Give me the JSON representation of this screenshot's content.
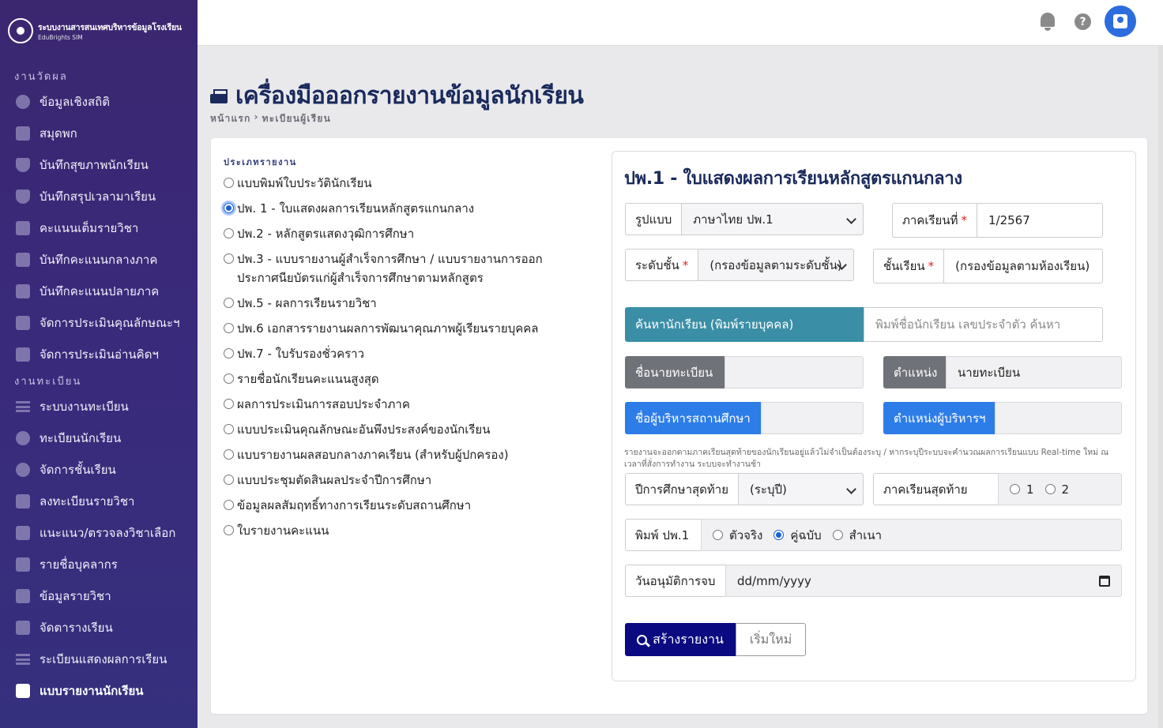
{
  "brand": {
    "title": "ระบบงานสารสนเทศบริหารข้อมูลโรงเรียน",
    "subtitle": "EduBrights SIM"
  },
  "sidebar": {
    "section1": "งานวัดผล",
    "items1": [
      {
        "label": "ข้อมูลเชิงสถิติ",
        "icon": "pie-chart-icon"
      },
      {
        "label": "สมุดพก",
        "icon": "book-icon"
      },
      {
        "label": "บันทึกสุขภาพนักเรียน",
        "icon": "shield-icon"
      },
      {
        "label": "บันทึกสรุปเวลามาเรียน",
        "icon": "shield-icon"
      },
      {
        "label": "คะแนนเต็มรายวิชา",
        "icon": "book-icon"
      },
      {
        "label": "บันทึกคะแนนกลางภาค",
        "icon": "book-icon"
      },
      {
        "label": "บันทึกคะแนนปลายภาค",
        "icon": "book-icon"
      },
      {
        "label": "จัดการประเมินคุณลักษณะฯ",
        "icon": "book-icon"
      },
      {
        "label": "จัดการประเมินอ่านคิดฯ",
        "icon": "book-icon"
      }
    ],
    "section2": "งานทะเบียน",
    "items2": [
      {
        "label": "ระบบงานทะเบียน",
        "icon": "list-icon"
      },
      {
        "label": "ทะเบียนนักเรียน",
        "icon": "face-icon"
      },
      {
        "label": "จัดการชั้นเรียน",
        "icon": "user-icon"
      },
      {
        "label": "ลงทะเบียนรายวิชา",
        "icon": "checklist-icon"
      },
      {
        "label": "แนะแนว/ตรวจลงวิชาเลือก",
        "icon": "plus-box-icon"
      },
      {
        "label": "รายชื่อบุคลากร",
        "icon": "badge-icon"
      },
      {
        "label": "ข้อมูลรายวิชา",
        "icon": "open-book-icon"
      },
      {
        "label": "จัดตารางเรียน",
        "icon": "calendar-icon"
      },
      {
        "label": "ระเบียนแสดงผลการเรียน",
        "icon": "list-icon"
      },
      {
        "label": "แบบรายงานนักเรียน",
        "icon": "print-icon",
        "active": true
      }
    ]
  },
  "header": {
    "title": "เครื่องมือออกรายงานข้อมูลนักเรียน",
    "crumb_home": "หน้าแรก",
    "crumb_sep": "›",
    "crumb_current": "ทะเบียนผู้เรียน"
  },
  "report_types": {
    "label": "ประเภทรายงาน",
    "options": [
      "แบบพิมพ์ใบประวัตินักเรียน",
      "ปพ. 1 - ใบแสดงผลการเรียนหลักสูตรแกนกลาง",
      "ปพ.2 - หลักสูตรแสดงวุฒิการศึกษา",
      "ปพ.3 - แบบรายงานผู้สำเร็จการศึกษา / แบบรายงานการออกประกาศนียบัตรแก่ผู้สำเร็จการศึกษาตามหลักสูตร",
      "ปพ.5 - ผลการเรียนรายวิชา",
      "ปพ.6 เอกสารรายงานผลการพัฒนาคุณภาพผู้เรียนรายบุคคล",
      "ปพ.7 - ใบรับรองชั่วคราว",
      "รายชื่อนักเรียนคะแนนสูงสุด",
      "ผลการประเมินการสอบประจำภาค",
      "แบบประเมินคุณลักษณะอันพึงประสงค์ของนักเรียน",
      "แบบรายงานผลสอบกลางภาคเรียน (สำหรับผู้ปกครอง)",
      "แบบประชุมตัดสินผลประจำปีการศึกษา",
      "ข้อมูลผลสัมฤทธิ์ทางการเรียนระดับสถานศึกษา",
      "ใบรายงานคะแนน"
    ],
    "selected_index": 1
  },
  "form": {
    "title": "ปพ.1 - ใบแสดงผลการเรียนหลักสูตรแกนกลาง",
    "format_label": "รูปแบบ",
    "format_value": "ภาษาไทย ปพ.1",
    "semester_label": "ภาคเรียนที่",
    "semester_value": "1/2567",
    "level_label": "ระดับชั้น",
    "level_value": "(กรองข้อมูลตามระดับชั้น)",
    "class_label": "ชั้นเรียน",
    "class_value": "(กรองข้อมูลตามห้องเรียน)",
    "search_label": "ค้นหานักเรียน (พิมพ์รายบุคคล)",
    "search_placeholder": "พิมพ์ชื่อนักเรียน เลขประจำตัว ค้นหา",
    "registrar_label": "ชื่อนายทะเบียน",
    "registrar_value": "",
    "position_label": "ตำแหน่ง",
    "position_value": "นายทะเบียน",
    "director_label": "ชื่อผู้บริหารสถานศึกษา",
    "director_value": "",
    "director_pos_label": "ตำแหน่งผู้บริหารฯ",
    "director_pos_value": "",
    "note": "รายงานจะออกตามภาคเรียนสุดท้ายของนักเรียนอยู่แล้วไม่จำเป็นต้องระบุ / หากระบุปีระบบจะคำนวณผลการเรียนแบบ Real-time ใหม่ ณ เวลาที่สั่งการทำงาน ระบบจะทำงานช้า",
    "last_year_label": "ปีการศึกษาสุดท้าย",
    "last_year_value": "(ระบุปี)",
    "last_sem_label": "ภาคเรียนสุดท้าย",
    "last_sem_options": [
      "1",
      "2"
    ],
    "print_label": "พิมพ์ ปพ.1",
    "print_options": [
      "ตัวจริง",
      "คู่ฉบับ",
      "สำเนา"
    ],
    "print_selected": 1,
    "approve_label": "วันอนุมัติการจบ",
    "approve_placeholder": "dd/mm/yyyy",
    "create_button": "สร้างรายงาน",
    "reset_button": "เริ่มใหม่"
  }
}
